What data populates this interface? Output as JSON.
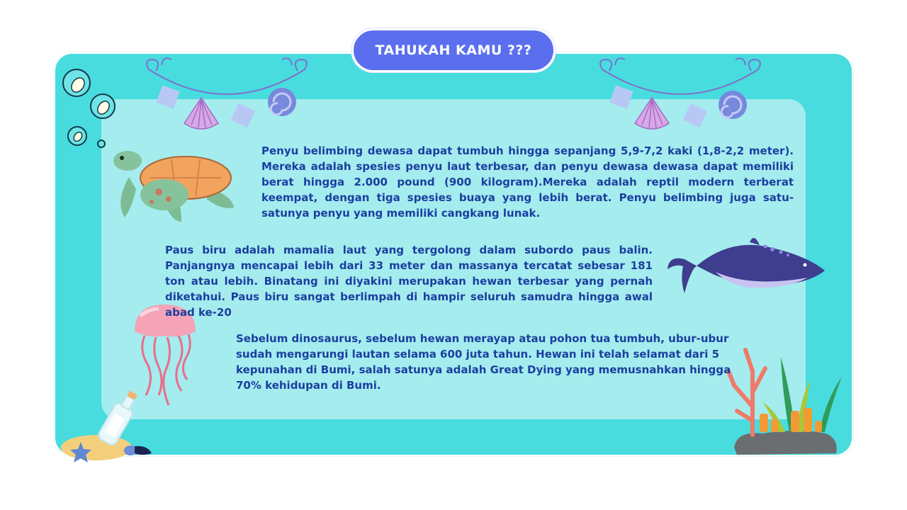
{
  "title": "TAHUKAH KAMU ???",
  "paragraphs": [
    "Penyu belimbing dewasa dapat tumbuh hingga sepanjang 5,9-7,2 kaki (1,8-2,2 meter). Mereka adalah spesies penyu laut terbesar, dan penyu dewasa dewasa dapat memiliki berat hingga 2.000 pound (900 kilogram).Mereka adalah reptil modern terberat keempat, dengan tiga spesies buaya yang lebih berat. Penyu belimbing juga satu-satunya penyu yang memiliki cangkang lunak.",
    "Paus biru adalah mamalia laut yang tergolong dalam subordo paus balin. Panjangnya mencapai lebih dari 33 meter dan massanya tercatat sebesar 181 ton atau lebih. Binatang ini diyakini merupakan hewan terbesar yang pernah diketahui. Paus biru sangat berlimpah di hampir seluruh samudra hingga awal abad ke-20",
    "Sebelum dinosaurus, sebelum hewan merayap atau pohon tua tumbuh, ubur-ubur sudah mengarungi lautan selama 600 juta tahun. Hewan ini telah selamat dari 5 kepunahan di Bumi, salah satunya adalah Great Dying yang memusnahkan hingga 70% kehidupan di Bumi."
  ],
  "colors": {
    "frame": "#48dcdf",
    "panel": "#a4ecee",
    "title_pill": "#5b6fee",
    "text": "#1b3fa0"
  },
  "icons": [
    "bubbles-illustration",
    "shell-garland-illustration",
    "turtle-illustration",
    "whale-illustration",
    "jellyfish-illustration",
    "bottle-sand-illustration",
    "coral-illustration"
  ]
}
